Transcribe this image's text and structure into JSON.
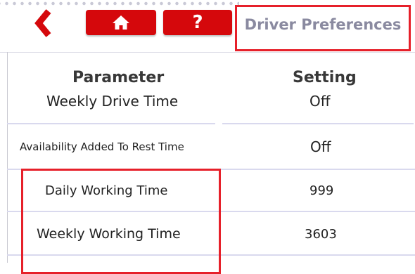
{
  "header": {
    "back_icon": "chevron-left-icon",
    "home_icon": "home-icon",
    "help_label": "?",
    "title": "Driver Preferences"
  },
  "table": {
    "columns": [
      "Parameter",
      "Setting"
    ],
    "rows": [
      {
        "parameter": "Weekly Drive Time",
        "setting": "Off"
      },
      {
        "parameter": "Availability Added To Rest Time",
        "setting": "Off"
      },
      {
        "parameter": "Daily Working Time",
        "setting": "999"
      },
      {
        "parameter": "Weekly Working Time",
        "setting": "3603"
      }
    ]
  },
  "colors": {
    "accent": "#d5080c",
    "highlight": "#e6202a",
    "title": "#8a8aa0"
  }
}
